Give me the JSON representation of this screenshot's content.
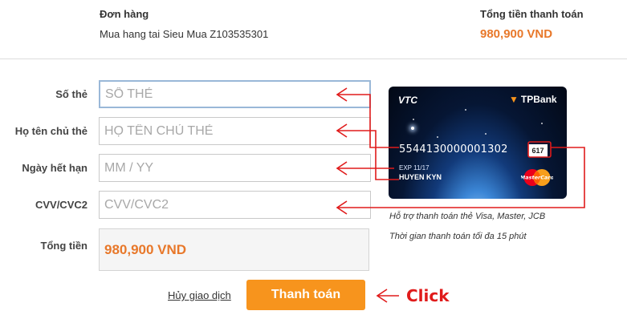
{
  "order": {
    "label": "Đơn hàng",
    "description": "Mua hang tai Sieu Mua Z103535301"
  },
  "total_header": {
    "label": "Tổng tiền thanh toán",
    "amount": "980,900 VND"
  },
  "form": {
    "card_number": {
      "label": "Số thẻ",
      "placeholder": "SỐ THẺ",
      "value": ""
    },
    "card_holder": {
      "label": "Họ tên chủ thẻ",
      "placeholder": "HỌ TÊN CHỦ THẺ",
      "value": ""
    },
    "expiry": {
      "label": "Ngày hết hạn",
      "placeholder": "MM / YY",
      "value": ""
    },
    "cvv": {
      "label": "CVV/CVC2",
      "placeholder": "CVV/CVC2",
      "value": ""
    },
    "total": {
      "label": "Tổng tiền",
      "value": "980,900 VND"
    }
  },
  "actions": {
    "cancel_label": "Hủy giao dịch",
    "pay_label": "Thanh toán",
    "click_annotation": "Click"
  },
  "card_image": {
    "issuer_logo": "VTC",
    "bank_logo": "TPBank",
    "number": "5544130000001302",
    "cvv": "617",
    "expiry": "EXP 11/17",
    "holder": "HUYEN KYN",
    "network": "MasterCard"
  },
  "notes": [
    "Hỗ trợ thanh toán thẻ Visa, Master, JCB",
    "Thời gian thanh toán tối đa 15 phút"
  ],
  "colors": {
    "accent": "#f7941d",
    "amount": "#e8782a",
    "annotation": "#e01b1b"
  }
}
